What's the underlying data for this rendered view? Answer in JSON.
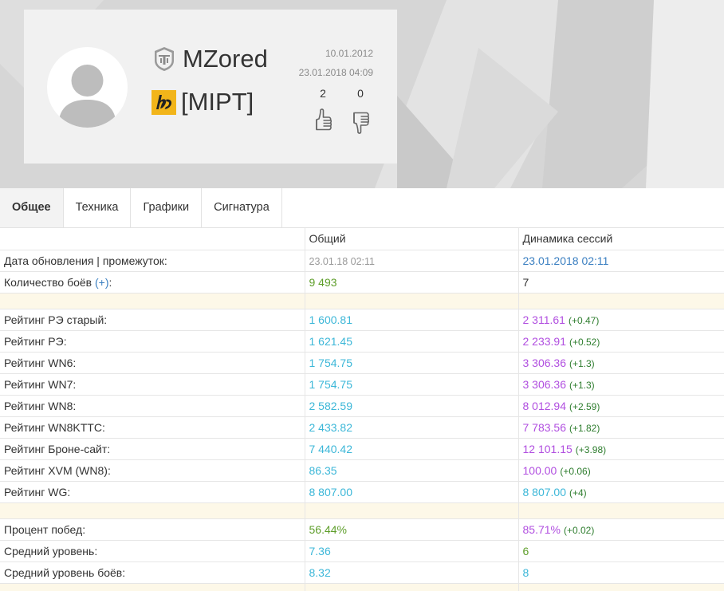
{
  "profile": {
    "player_name": "MZored",
    "clan_tag": "[MIPT]",
    "date_registered": "10.01.2012",
    "date_last_battle": "23.01.2018 04:09",
    "likes": "2",
    "dislikes": "0"
  },
  "tabs": [
    {
      "label": "Общее",
      "active": true
    },
    {
      "label": "Техника",
      "active": false
    },
    {
      "label": "Графики",
      "active": false
    },
    {
      "label": "Сигнатура",
      "active": false
    }
  ],
  "table": {
    "header": {
      "col_overall": "Общий",
      "col_session": "Динамика сессий"
    },
    "update_row": {
      "label": "Дата обновления | промежуток:",
      "overall": "23.01.18 02:11",
      "session": "23.01.2018 02:11"
    },
    "battles_row": {
      "label_prefix": "Количество боёв ",
      "label_plus": "(+)",
      "label_suffix": ":",
      "overall": "9 493",
      "session": "7"
    },
    "ratings": [
      {
        "label": "Рейтинг РЭ старый:",
        "overall": "1 600.81",
        "session": "2 311.61",
        "delta": "(+0.47)"
      },
      {
        "label": "Рейтинг РЭ:",
        "overall": "1 621.45",
        "session": "2 233.91",
        "delta": "(+0.52)"
      },
      {
        "label": "Рейтинг WN6:",
        "overall": "1 754.75",
        "session": "3 306.36",
        "delta": "(+1.3)"
      },
      {
        "label": "Рейтинг WN7:",
        "overall": "1 754.75",
        "session": "3 306.36",
        "delta": "(+1.3)"
      },
      {
        "label": "Рейтинг WN8:",
        "overall": "2 582.59",
        "session": "8 012.94",
        "delta": "(+2.59)"
      },
      {
        "label": "Рейтинг WN8KTTC:",
        "overall": "2 433.82",
        "session": "7 783.56",
        "delta": "(+1.82)"
      },
      {
        "label": "Рейтинг Броне-сайт:",
        "overall": "7 440.42",
        "session": "12 101.15",
        "delta": "(+3.98)"
      },
      {
        "label": "Рейтинг XVM (WN8):",
        "overall": "86.35",
        "session": "100.00",
        "delta": "(+0.06)"
      },
      {
        "label": "Рейтинг WG:",
        "overall": "8 807.00",
        "session": "8 807.00",
        "delta": "(+4)"
      }
    ],
    "winrate_row": {
      "label": "Процент побед:",
      "overall": "56.44%",
      "session": "85.71%",
      "delta": "(+0.02)"
    },
    "avg_tier_row": {
      "label": "Средний уровень:",
      "overall": "7.36",
      "session": "6"
    },
    "avg_battle_tier_row": {
      "label": "Средний уровень боёв:",
      "overall": "8.32",
      "session": "8"
    }
  },
  "icons": {
    "wot_logo": "wot-logo-icon",
    "clan_logo": "clan-emblem-icon",
    "like": "thumbs-up-icon",
    "dislike": "thumbs-down-icon",
    "avatar": "default-avatar-icon"
  },
  "colors": {
    "overall_rating": "#3cb7d8",
    "session_rating": "#b14fe0",
    "delta": "#2e7d2e",
    "link": "#3a7fc1",
    "separator_row": "#fdf8e8",
    "clan_emblem": "#f2b51a"
  }
}
